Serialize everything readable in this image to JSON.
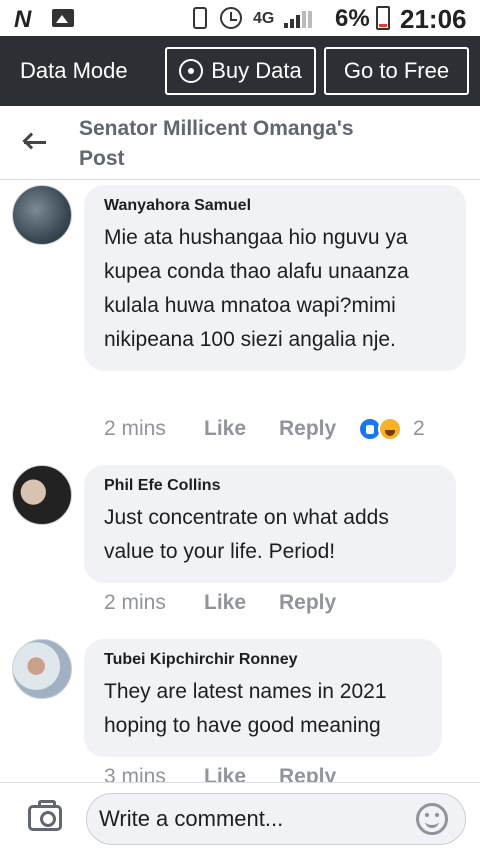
{
  "status_bar": {
    "logo": "N",
    "network": "4G",
    "battery": "6%",
    "time": "21:06"
  },
  "data_bar": {
    "mode_label": "Data Mode",
    "buy_label": "Buy Data",
    "free_label": "Go to Free"
  },
  "header": {
    "title": "Senator Millicent Omanga's Post"
  },
  "comments": [
    {
      "author": "Wanyahora Samuel",
      "text": "Mie ata hushangaa hio nguvu ya kupea conda thao alafu unaanza kulala huwa mnatoa wapi?mimi nikipeana 100 siezi angalia nje.",
      "time": "2 mins",
      "like": "Like",
      "reply": "Reply",
      "reactions": [
        "like",
        "haha"
      ],
      "reaction_count": "2"
    },
    {
      "author": "Phil Efe Collins",
      "text": "Just concentrate on what adds value to your life. Period!",
      "time": "2 mins",
      "like": "Like",
      "reply": "Reply"
    },
    {
      "author": "Tubei Kipchirchir Ronney",
      "text": "They are latest names in 2021 hoping to have good meaning",
      "time": "3 mins",
      "like": "Like",
      "reply": "Reply"
    }
  ],
  "compose": {
    "placeholder": "Write a comment..."
  },
  "colors": {
    "data_bar_bg": "#2c2f33",
    "bubble_bg": "#f0f2f5",
    "like_blue": "#1877f2",
    "haha_yellow": "#f7b125",
    "meta_gray": "#90949c"
  },
  "icons": [
    "n-logo-icon",
    "gallery-icon",
    "phone-icon",
    "alarm-icon",
    "signal-icon",
    "battery-icon",
    "broadcast-icon",
    "back-arrow-icon",
    "like-reaction-icon",
    "haha-reaction-icon",
    "camera-icon",
    "emoji-icon"
  ]
}
